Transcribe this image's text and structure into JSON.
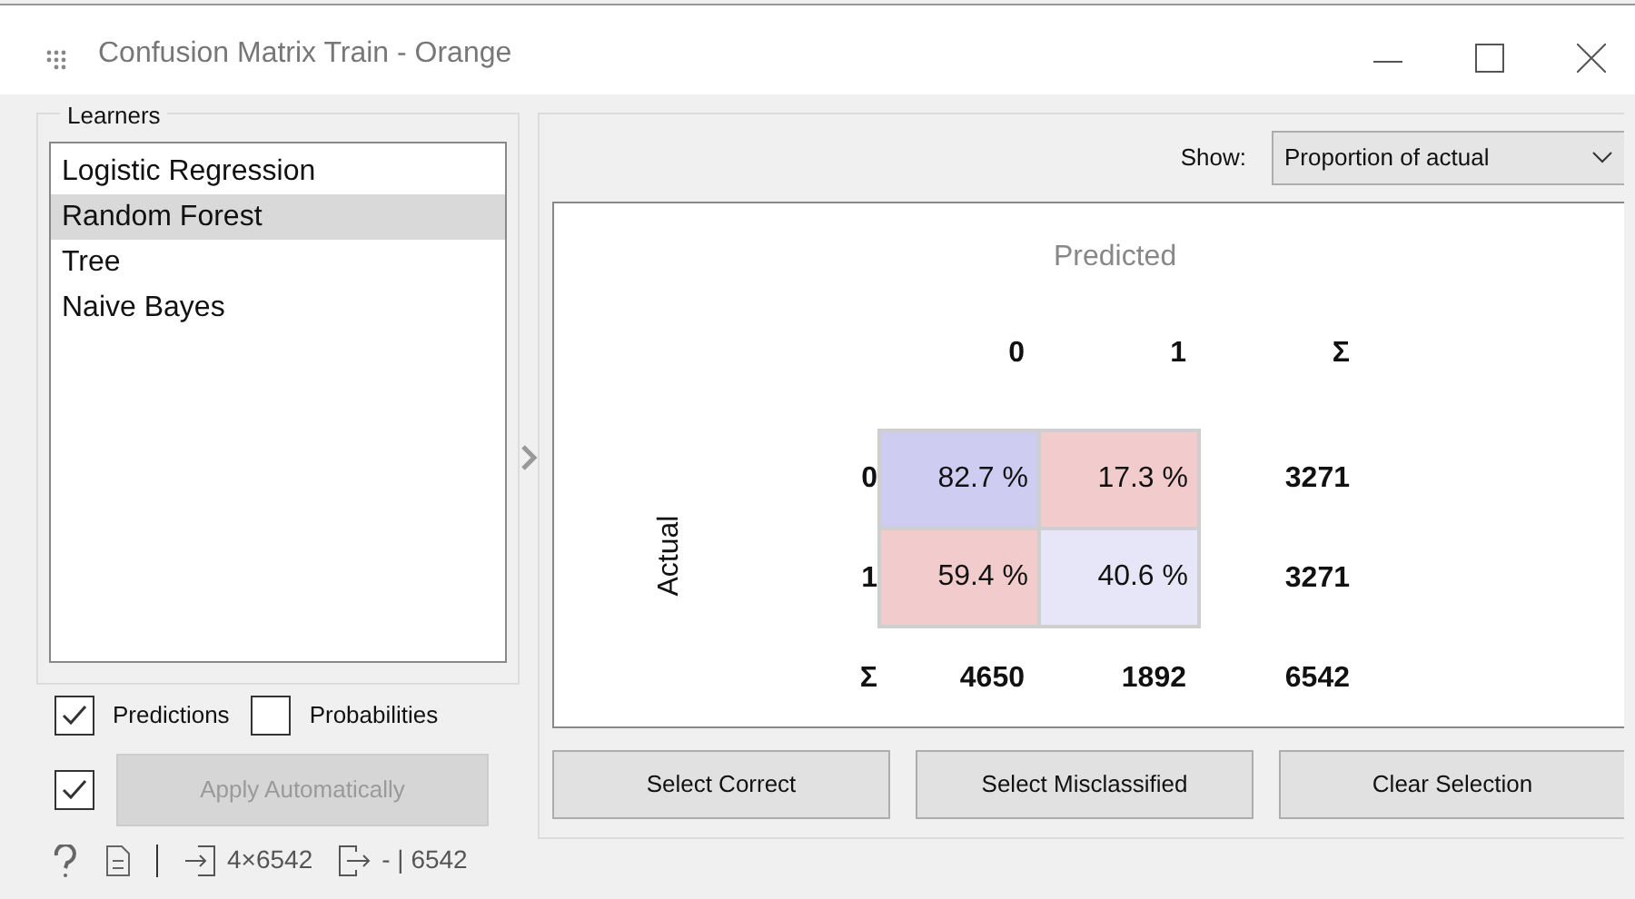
{
  "window": {
    "title": "Confusion Matrix Train - Orange"
  },
  "learners": {
    "title": "Learners",
    "items": [
      {
        "label": "Logistic Regression",
        "selected": false
      },
      {
        "label": "Random Forest",
        "selected": true
      },
      {
        "label": "Tree",
        "selected": false
      },
      {
        "label": "Naive Bayes",
        "selected": false
      }
    ]
  },
  "options": [
    {
      "label": "Predictions",
      "checked": true
    },
    {
      "label": "Probabilities",
      "checked": false
    }
  ],
  "apply": {
    "checked": true,
    "label": "Apply Automatically",
    "disabled": true
  },
  "show": {
    "label": "Show:",
    "value": "Proportion of actual"
  },
  "matrix": {
    "predicted_label": "Predicted",
    "actual_label": "Actual",
    "columns": [
      "0",
      "1",
      "Σ"
    ],
    "rows": [
      {
        "label": "0",
        "cells": [
          {
            "text": "82.7 %",
            "color": "#ceccf0"
          },
          {
            "text": "17.3 %",
            "color": "#f2cccc"
          }
        ],
        "total": "3271"
      },
      {
        "label": "1",
        "cells": [
          {
            "text": "59.4 %",
            "color": "#f2cccc"
          },
          {
            "text": "40.6 %",
            "color": "#e7e6f8"
          }
        ],
        "total": "3271"
      }
    ],
    "totals": {
      "label": "Σ",
      "values": [
        "4650",
        "1892",
        "6542"
      ]
    }
  },
  "buttons": [
    "Select Correct",
    "Select Misclassified",
    "Clear Selection"
  ],
  "status_bar": {
    "input": "4×6542",
    "output": "- | 6542"
  }
}
